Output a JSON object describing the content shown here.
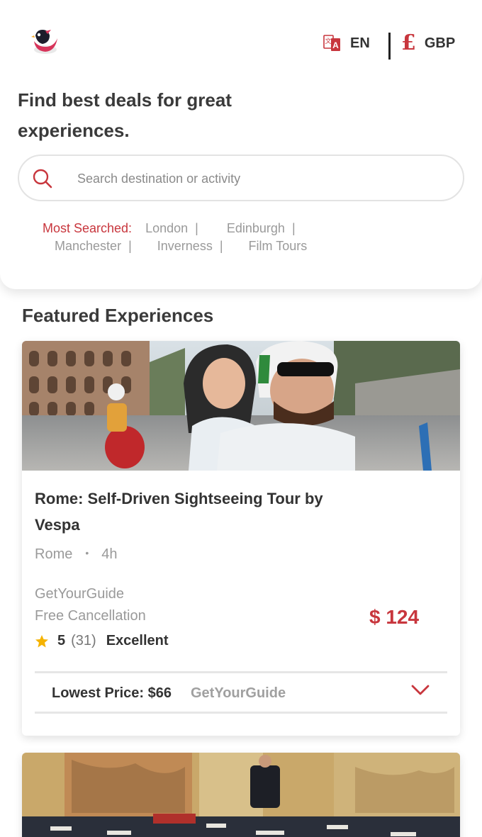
{
  "header": {
    "language": {
      "icon": "translate-icon",
      "label": "EN"
    },
    "currency": {
      "icon": "pound-icon",
      "symbol": "£",
      "label": "GBP"
    },
    "headline": "Find best deals for great experiences.",
    "search": {
      "placeholder": "Search destination or activity",
      "icon": "search-icon"
    },
    "most_searched": {
      "title": "Most Searched:",
      "items": [
        "London",
        "Edinburgh",
        "Manchester",
        "Inverness",
        "Film Tours"
      ]
    }
  },
  "featured": {
    "title": "Featured Experiences",
    "cards": [
      {
        "title": "Rome: Self-Driven Sightseeing Tour by Vespa",
        "location": "Rome",
        "duration": "4h",
        "provider": "GetYourGuide",
        "cancellation": "Free Cancellation",
        "rating_score": "5",
        "rating_count": "(31)",
        "rating_label": "Excellent",
        "price": "$ 124",
        "lowest_price_label": "Lowest Price: $66",
        "lowest_price_provider": "GetYourGuide"
      }
    ]
  },
  "colors": {
    "accent": "#c8363d",
    "muted": "#9a9a9a",
    "star": "#f5b301"
  }
}
